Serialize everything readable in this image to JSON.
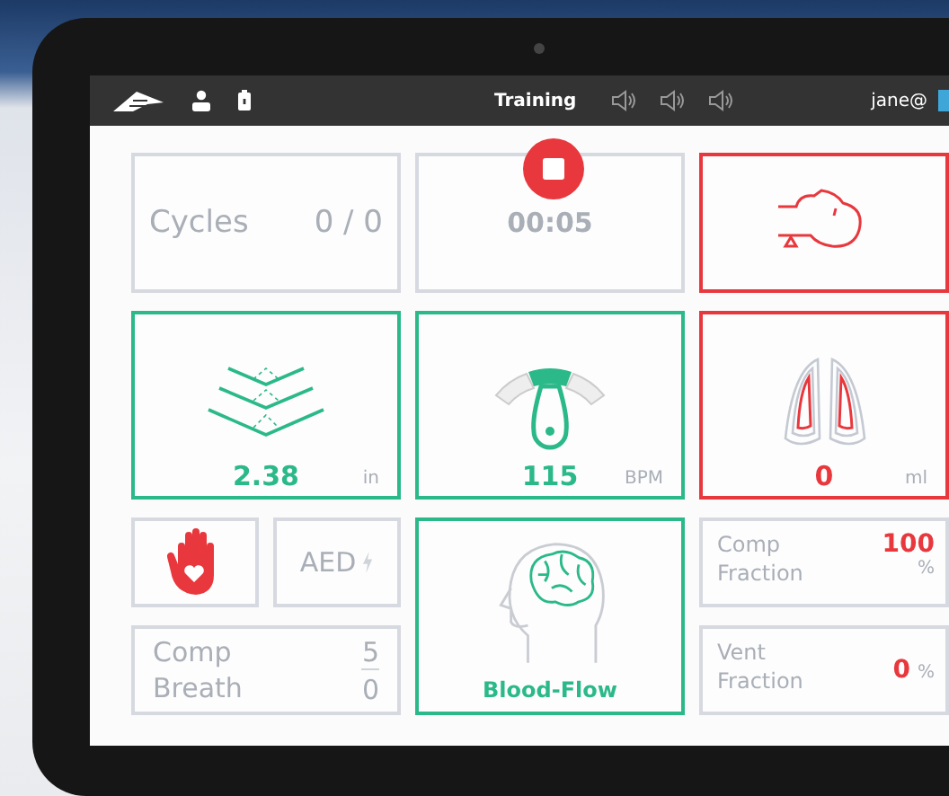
{
  "top_bar": {
    "mode": "Training",
    "user": "jane@"
  },
  "tiles": [
    {
      "kind": "counter",
      "label": "Cycles",
      "value": "0 / 0",
      "color": "#d6d9df"
    },
    {
      "kind": "timer",
      "value": "00:05",
      "color": "#d6d9df"
    },
    {
      "kind": "airway",
      "color": "#e8383d"
    },
    {
      "kind": "depth",
      "value": "2.38",
      "unit": "in",
      "color": "#2bb98a"
    },
    {
      "kind": "rate",
      "value": "115",
      "unit": "BPM",
      "color": "#2bb98a"
    },
    {
      "kind": "volume",
      "value": "0",
      "unit": "ml",
      "color": "#e8383d"
    },
    {
      "kind": "hand",
      "color": "#d6d9df"
    },
    {
      "kind": "aed",
      "label": "AED",
      "color": "#d6d9df"
    },
    {
      "kind": "brain",
      "label": "Blood-Flow",
      "color": "#2bb98a"
    },
    {
      "kind": "fraction",
      "label": "Comp Fraction",
      "value": "100",
      "unit": "%",
      "color": "#d6d9df"
    },
    {
      "kind": "ratio",
      "labels": [
        "Comp",
        "Breath"
      ],
      "values": [
        "5",
        "0"
      ],
      "color": "#d6d9df"
    },
    {
      "kind": "fraction",
      "label": "Vent Fraction",
      "value": "0",
      "unit": "%",
      "color": "#d6d9df"
    }
  ]
}
